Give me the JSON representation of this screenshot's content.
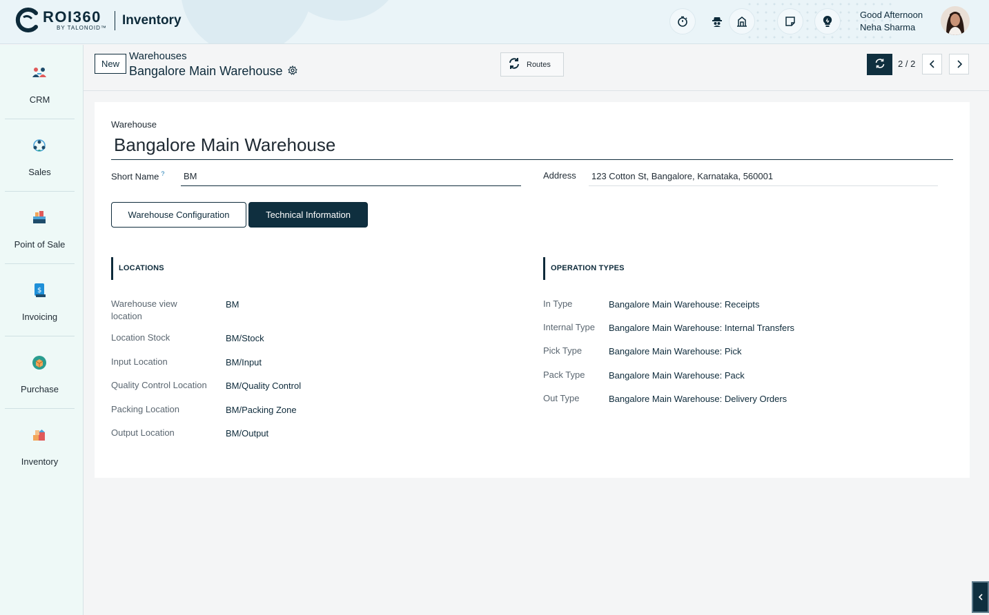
{
  "header": {
    "logo_brand": "ROI360",
    "logo_sub": "BY TALONOID™",
    "app_title": "Inventory",
    "greeting": "Good Afternoon",
    "user_name": "Neha Sharma",
    "icons": [
      "timer-icon",
      "spy-icon",
      "building-icon",
      "note-icon",
      "lightbulb-icon"
    ]
  },
  "sidebar": {
    "items": [
      {
        "label": "CRM",
        "icon": "crm-icon"
      },
      {
        "label": "Sales",
        "icon": "sales-icon"
      },
      {
        "label": "Point of Sale",
        "icon": "point-of-sale-icon"
      },
      {
        "label": "Invoicing",
        "icon": "invoicing-icon"
      },
      {
        "label": "Purchase",
        "icon": "purchase-icon"
      },
      {
        "label": "Inventory",
        "icon": "inventory-icon"
      }
    ]
  },
  "controlbar": {
    "new_label": "New",
    "breadcrumb_parent": "Warehouses",
    "breadcrumb_current": "Bangalore Main Warehouse",
    "routes_label": "Routes",
    "pager": "2 / 2"
  },
  "form": {
    "warehouse_label": "Warehouse",
    "warehouse_name": "Bangalore Main Warehouse",
    "short_name_label": "Short Name",
    "short_name_help": "?",
    "short_name_value": "BM",
    "address_label": "Address",
    "address_value": "123 Cotton St, Bangalore, Karnataka, 560001",
    "tabs": [
      {
        "label": "Warehouse Configuration",
        "active": false
      },
      {
        "label": "Technical Information",
        "active": true
      }
    ],
    "locations": {
      "title": "LOCATIONS",
      "rows": [
        {
          "label": "Warehouse view location",
          "value": "BM"
        },
        {
          "label": "Location Stock",
          "value": "BM/Stock"
        },
        {
          "label": "Input Location",
          "value": "BM/Input"
        },
        {
          "label": "Quality Control Location",
          "value": "BM/Quality Control"
        },
        {
          "label": "Packing Location",
          "value": "BM/Packing Zone"
        },
        {
          "label": "Output Location",
          "value": "BM/Output"
        }
      ]
    },
    "operation_types": {
      "title": "OPERATION TYPES",
      "rows": [
        {
          "label": "In Type",
          "value": "Bangalore Main Warehouse: Receipts"
        },
        {
          "label": "Internal Type",
          "value": "Bangalore Main Warehouse: Internal Transfers"
        },
        {
          "label": "Pick Type",
          "value": "Bangalore Main Warehouse: Pick"
        },
        {
          "label": "Pack Type",
          "value": "Bangalore Main Warehouse: Pack"
        },
        {
          "label": "Out Type",
          "value": "Bangalore Main Warehouse: Delivery Orders"
        }
      ]
    }
  },
  "colors": {
    "primary": "#0f2f3f",
    "sidebar_bg": "#eef9f7",
    "header_bg": "#eaf4f8",
    "link": "#0d2a3a"
  }
}
